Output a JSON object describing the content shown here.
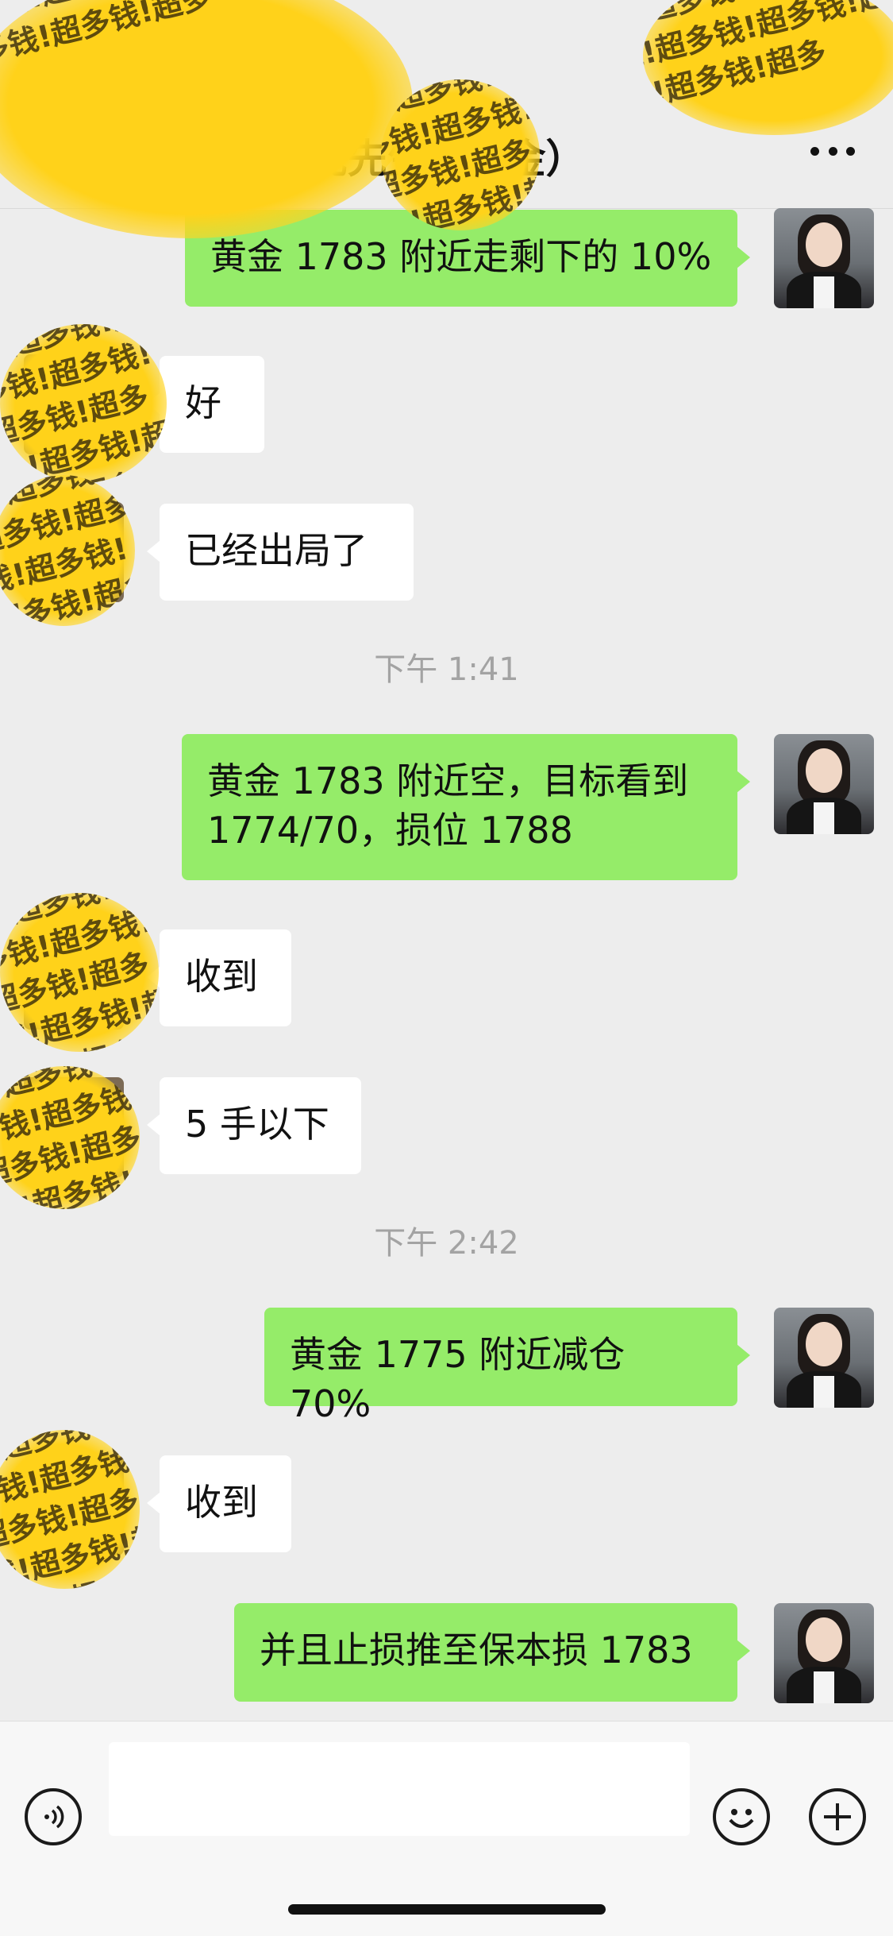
{
  "header": {
    "title": "沈先生（美金）",
    "more_icon": "more-dots-icon"
  },
  "messages": [
    {
      "side": "me",
      "text": "黄金 1783 附近走剩下的 10%"
    },
    {
      "side": "them",
      "text": "好"
    },
    {
      "side": "them",
      "text": "已经出局了"
    },
    {
      "type": "time",
      "text": "下午 1:41"
    },
    {
      "side": "me",
      "text": "黄金 1783 附近空，目标看到\n1774/70，损位 1788"
    },
    {
      "side": "them",
      "text": "收到"
    },
    {
      "side": "them",
      "text": "5 手以下"
    },
    {
      "type": "time",
      "text": "下午 2:42"
    },
    {
      "side": "me",
      "text": "黄金 1775 附近减仓 70%"
    },
    {
      "side": "them",
      "text": "收到"
    },
    {
      "side": "me",
      "text": "并且止损推至保本损 1783"
    }
  ],
  "footer": {
    "voice_icon": "voice-icon",
    "emoji_icon": "emoji-icon",
    "plus_icon": "plus-icon",
    "input_value": ""
  },
  "colors": {
    "bubble_me": "#95ec69",
    "bubble_them": "#ffffff",
    "background": "#ededed"
  }
}
